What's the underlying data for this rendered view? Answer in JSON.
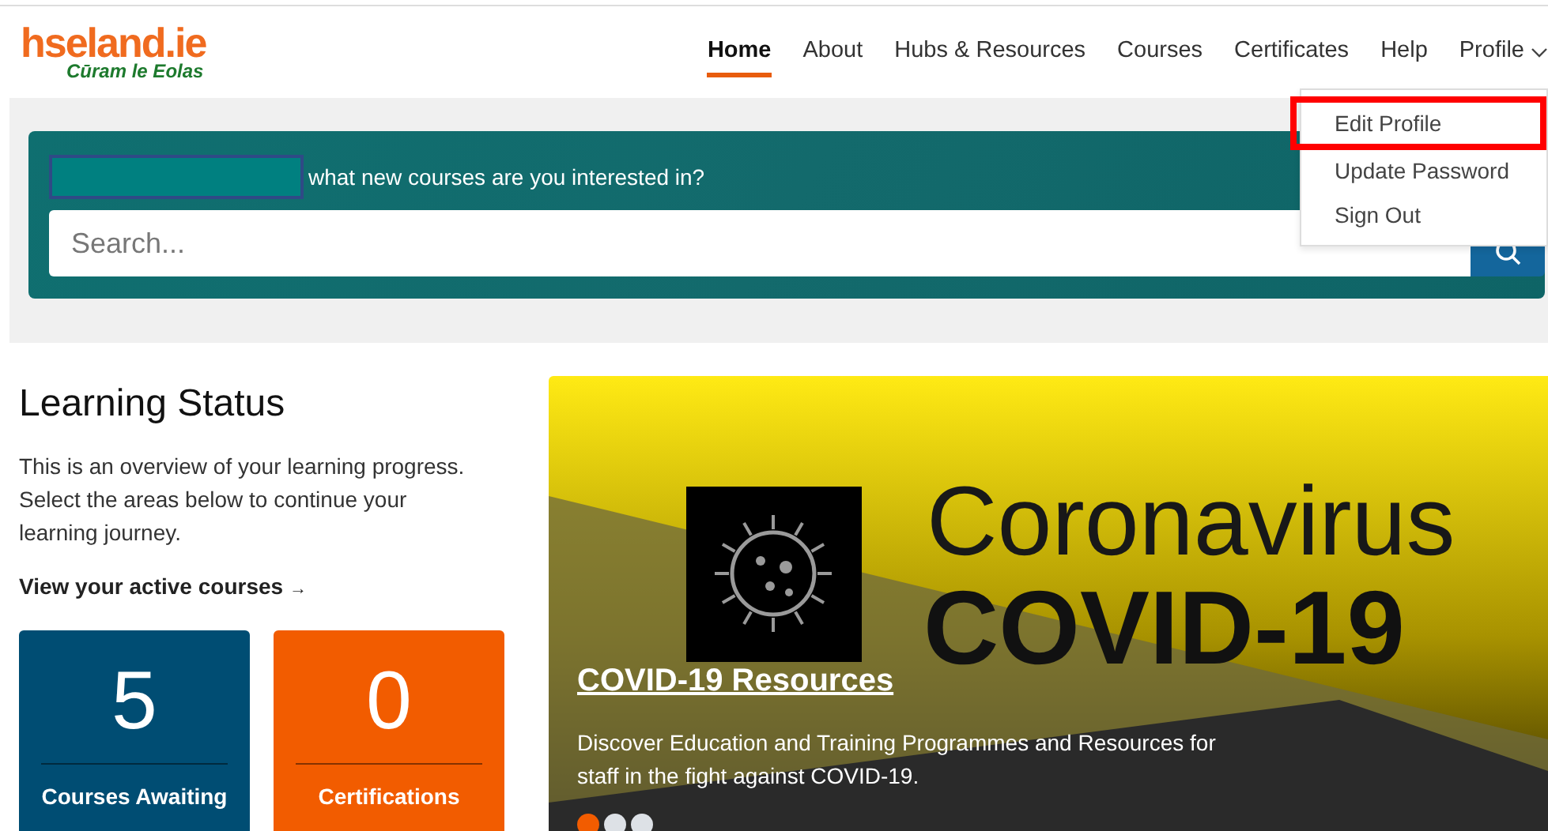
{
  "header": {
    "logo": {
      "name": "hseland.ie",
      "tagline": "Cūram le Eolas"
    },
    "nav": [
      {
        "label": "Home",
        "selected": true
      },
      {
        "label": "About",
        "selected": false
      },
      {
        "label": "Hubs & Resources",
        "selected": false
      },
      {
        "label": "Courses",
        "selected": false
      },
      {
        "label": "Certificates",
        "selected": false
      },
      {
        "label": "Help",
        "selected": false
      },
      {
        "label": "Profile",
        "selected": false,
        "expanded": true
      }
    ],
    "profile_menu": [
      {
        "label": "Edit Profile",
        "highlighted": true
      },
      {
        "label": "Update Password",
        "highlighted": false
      },
      {
        "label": "Sign Out",
        "highlighted": false
      }
    ]
  },
  "search_banner": {
    "prompt": "what new courses are you interested in?",
    "search": {
      "placeholder": "Search..."
    }
  },
  "learning_status": {
    "title": "Learning Status",
    "intro": "This is an overview of your learning progress. Select the areas below to continue your learning journey.",
    "link": "View your active courses",
    "link_arrow": "→",
    "tiles": [
      {
        "count": "5",
        "label": "Courses Awaiting",
        "color": "#004d73"
      },
      {
        "count": "0",
        "label": "Certifications",
        "color": "#f25c00"
      }
    ]
  },
  "carousel": {
    "image_text": [
      "Coronavirus",
      "COVID-19"
    ],
    "title": "COVID-19 Resources",
    "text": "Discover Education and Training Programmes and Resources for staff in the fight against COVID-19.",
    "slides": [
      {
        "selected": true
      },
      {
        "selected": false
      },
      {
        "selected": false
      }
    ]
  }
}
